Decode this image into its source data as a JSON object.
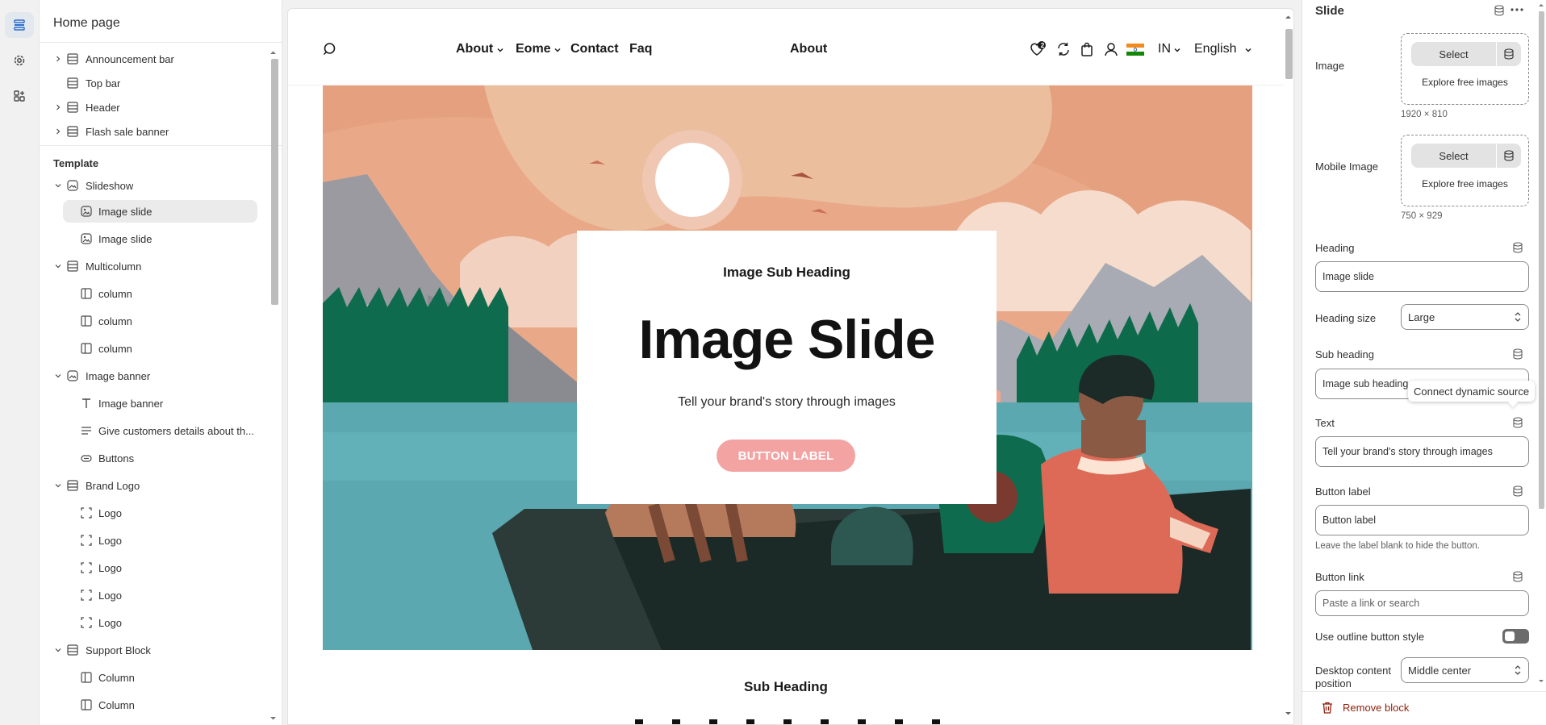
{
  "left_panel": {
    "title": "Home page",
    "header_items": [
      {
        "label": "Announcement bar"
      },
      {
        "label": "Top bar"
      },
      {
        "label": "Header"
      },
      {
        "label": "Flash sale banner"
      }
    ],
    "template_label": "Template",
    "tree": [
      {
        "label": "Slideshow"
      },
      {
        "label": "Image slide"
      },
      {
        "label": "Image slide"
      },
      {
        "label": "Multicolumn"
      },
      {
        "label": "column"
      },
      {
        "label": "column"
      },
      {
        "label": "column"
      },
      {
        "label": "Image banner"
      },
      {
        "label": "Image banner"
      },
      {
        "label": "Give customers details about th..."
      },
      {
        "label": "Buttons"
      },
      {
        "label": "Brand Logo"
      },
      {
        "label": "Logo"
      },
      {
        "label": "Logo"
      },
      {
        "label": "Logo"
      },
      {
        "label": "Logo"
      },
      {
        "label": "Logo"
      },
      {
        "label": "Support Block"
      },
      {
        "label": "Column"
      },
      {
        "label": "Column"
      }
    ]
  },
  "store": {
    "nav": [
      "About",
      "Eome",
      "Contact",
      "Faq"
    ],
    "center_link": "About",
    "wishlist_count": "2",
    "country": "IN",
    "language": "English"
  },
  "hero": {
    "sub_heading": "Image Sub Heading",
    "title": "Image Slide",
    "text": "Tell your brand's story through images",
    "button": "BUTTON LABEL"
  },
  "below": {
    "sub_heading": "Sub Heading"
  },
  "right_panel": {
    "title": "Slide",
    "image": {
      "label": "Image",
      "select": "Select",
      "explore": "Explore free images",
      "dimensions": "1920 × 810"
    },
    "mobile_image": {
      "label": "Mobile Image",
      "select": "Select",
      "explore": "Explore free images",
      "dimensions": "750 × 929"
    },
    "heading": {
      "label": "Heading",
      "value": "Image slide"
    },
    "heading_size": {
      "label": "Heading size",
      "value": "Large"
    },
    "sub_heading": {
      "label": "Sub heading",
      "value": "Image sub heading"
    },
    "tooltip": "Connect dynamic source",
    "text": {
      "label": "Text",
      "value": "Tell your brand's story through images"
    },
    "button_label": {
      "label": "Button label",
      "value": "Button label",
      "help": "Leave the label blank to hide the button."
    },
    "button_link": {
      "label": "Button link",
      "placeholder": "Paste a link or search"
    },
    "outline_toggle": {
      "label": "Use outline button style"
    },
    "desktop_position": {
      "label": "Desktop content position",
      "value": "Middle center"
    },
    "remove": "Remove block"
  },
  "colors": {
    "accent_button": "#f4a3a3",
    "remove_red": "#8e1f0b",
    "selected_row": "#ebebeb"
  }
}
